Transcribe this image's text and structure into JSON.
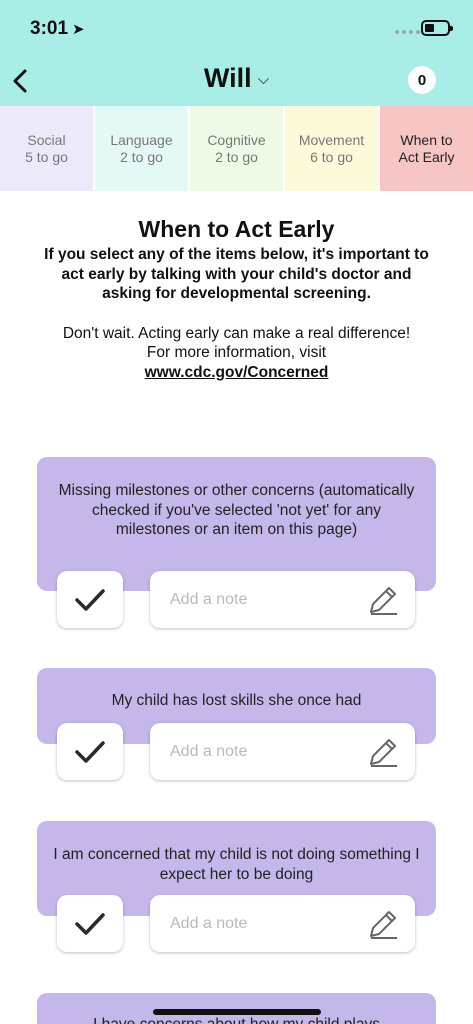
{
  "status_bar": {
    "time": "3:01",
    "location_arrow": "location-arrow-icon"
  },
  "header": {
    "child_name": "Will",
    "badge_count": "0",
    "back_icon": "back-chevron-icon"
  },
  "tabs": [
    {
      "label": "Social",
      "sub": "5 to go"
    },
    {
      "label": "Language",
      "sub": "2 to go"
    },
    {
      "label": "Cognitive",
      "sub": "2 to go"
    },
    {
      "label": "Movement",
      "sub": "6 to go"
    },
    {
      "label": "When to",
      "sub": "Act Early"
    }
  ],
  "intro": {
    "title": "When to Act Early",
    "bold_text": "If you select any of the items below, it's important to act early by talking with your child's doctor and asking for developmental screening.",
    "normal_text": "Don't wait. Acting early can make a real difference! For more information, visit",
    "link": "www.cdc.gov/Concerned"
  },
  "items": [
    {
      "text": "Missing milestones or other concerns (automatically checked if you've selected 'not yet' for any milestones or an item on this page)",
      "checked": true,
      "note_placeholder": "Add a note"
    },
    {
      "text": "My child has lost skills she once had",
      "checked": true,
      "note_placeholder": "Add a note"
    },
    {
      "text": "I am concerned that my child is not doing something I expect her to be doing",
      "checked": true,
      "note_placeholder": "Add a note"
    },
    {
      "text": "I have concerns about how my child plays"
    }
  ],
  "colors": {
    "header_bg": "#a8ede6",
    "card_bg": "#c6b7ea",
    "active_tab": "#f8c5c5"
  }
}
